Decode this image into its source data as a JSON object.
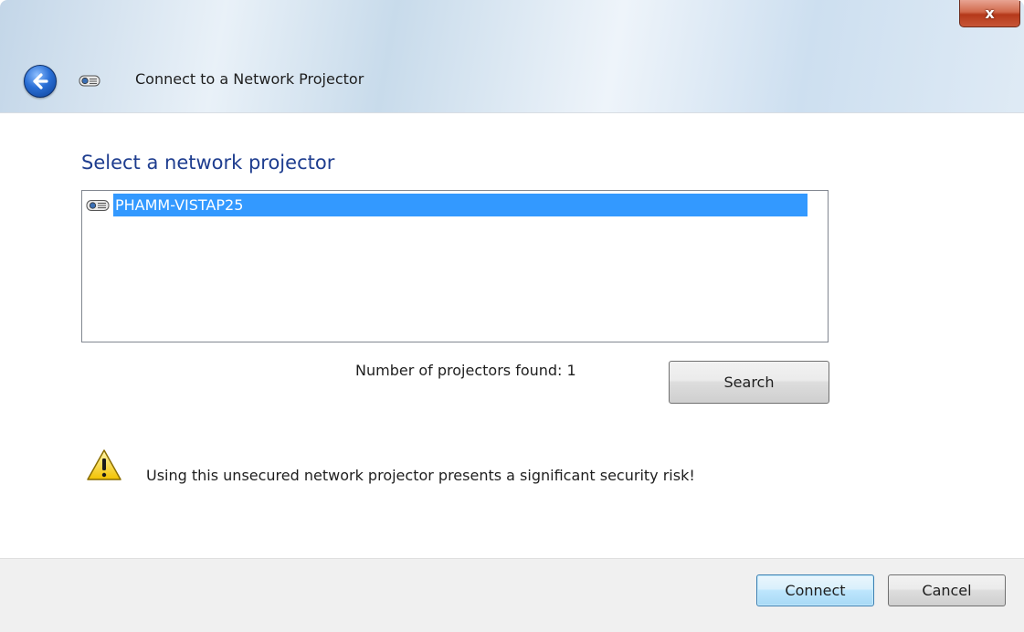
{
  "window": {
    "title": "Connect to a Network Projector",
    "close_label": "x"
  },
  "main": {
    "heading": "Select a network projector",
    "projectors": [
      {
        "name": "PHAMM-VISTAP25",
        "selected": true
      }
    ],
    "found_text": "Number of projectors found: 1",
    "search_label": "Search",
    "warning_text": "Using this unsecured network projector presents a significant security risk!"
  },
  "footer": {
    "connect_label": "Connect",
    "cancel_label": "Cancel"
  },
  "icons": {
    "back": "back-arrow-icon",
    "projector": "network-projector-icon",
    "warning": "warning-icon",
    "close": "close-icon"
  },
  "colors": {
    "heading": "#1e3d8f",
    "selection": "#3399ff",
    "close_button": "#c75637"
  }
}
